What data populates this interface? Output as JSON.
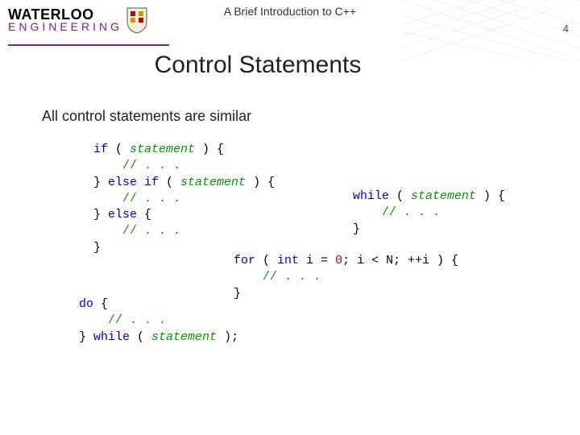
{
  "header": {
    "logo_top": "WATERLOO",
    "logo_bottom": "ENGINEERING",
    "doc_title": "A Brief Introduction to C++",
    "page_number": "4"
  },
  "slide": {
    "title": "Control Statements",
    "lead": "All control statements are similar"
  },
  "code": {
    "if_block": {
      "l1a": "if",
      "l1b": " ( ",
      "l1c": "statement",
      "l1d": " ) {",
      "l2a": "    ",
      "l2b": "// . . .",
      "l3a": "} ",
      "l3b": "else if",
      "l3c": " ( ",
      "l3d": "statement",
      "l3e": " ) {",
      "l4a": "    ",
      "l4b": "// . . .",
      "l5a": "} ",
      "l5b": "else",
      "l5c": " {",
      "l6a": "    ",
      "l6b": "// . . .",
      "l7": "}"
    },
    "while_block": {
      "l1a": "while",
      "l1b": " ( ",
      "l1c": "statement",
      "l1d": " ) {",
      "l2a": "    ",
      "l2b": "// . . .",
      "l3": "}"
    },
    "for_block": {
      "l1a": "for",
      "l1b": " ( ",
      "l1c": "int",
      "l1d": " i = ",
      "l1e": "0",
      "l1f": "; i < N; ++i ) {",
      "l2a": "    ",
      "l2b": "// . . .",
      "l3": "}"
    },
    "do_block": {
      "l1a": "do",
      "l1b": " {",
      "l2a": "    ",
      "l2b": "// . . .",
      "l3a": "} ",
      "l3b": "while",
      "l3c": " ( ",
      "l3d": "statement",
      "l3e": " );"
    }
  }
}
